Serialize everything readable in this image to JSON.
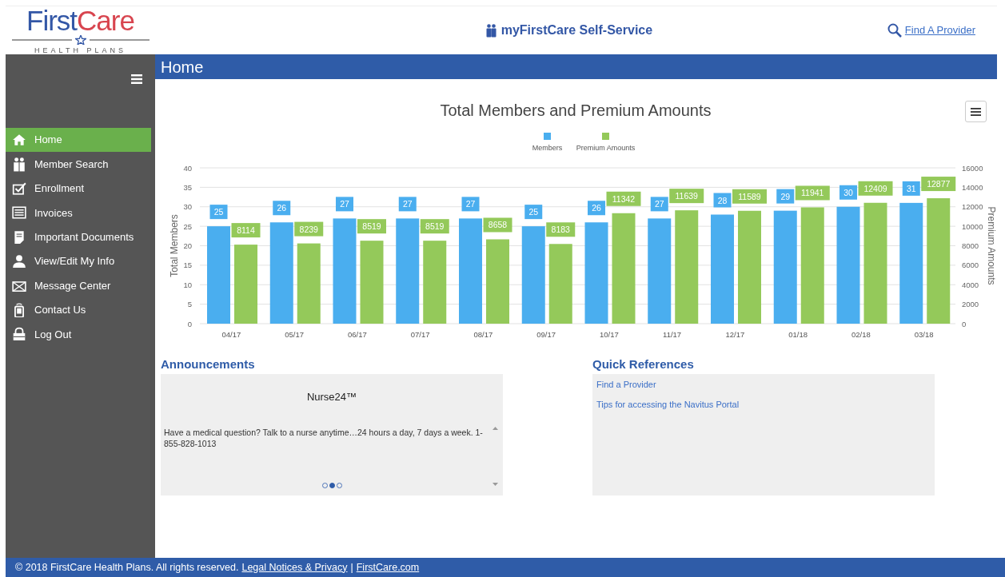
{
  "logo": {
    "brand_first": "First",
    "brand_second": "Care",
    "tagline": "HEALTH PLANS"
  },
  "header": {
    "title": "myFirstCare Self-Service",
    "link": "Find A Provider"
  },
  "sidebar": {
    "items": [
      {
        "label": "Home",
        "kind": "home",
        "selected": true
      },
      {
        "label": "Member Search",
        "kind": "members",
        "selected": false
      },
      {
        "label": "Enrollment",
        "kind": "checkbox",
        "selected": false
      },
      {
        "label": "Invoices",
        "kind": "list",
        "selected": false
      },
      {
        "label": "Important Documents",
        "kind": "document",
        "selected": false
      },
      {
        "label": "View/Edit My Info",
        "kind": "person",
        "selected": false
      },
      {
        "label": "Message Center",
        "kind": "mail",
        "selected": false
      },
      {
        "label": "Contact Us",
        "kind": "phone",
        "selected": false
      },
      {
        "label": "Log Out",
        "kind": "lock",
        "selected": false
      }
    ]
  },
  "page_title": "Home",
  "chart": {
    "chart_data": {
      "type": "bar",
      "title": "Total Members and Premium Amounts",
      "ylabel": "Total Members",
      "categories": [
        "04/17",
        "05/17",
        "06/17",
        "07/17",
        "08/17",
        "09/17",
        "10/17",
        "11/17",
        "12/17",
        "01/18",
        "02/18",
        "03/18"
      ],
      "series": [
        {
          "name": "Members",
          "color": "#4aaeef",
          "values": [
            25,
            26,
            27,
            27,
            27,
            25,
            26,
            27,
            28,
            29,
            30,
            31
          ]
        }
      ],
      "ylim": [
        0,
        40
      ],
      "yticks": [
        0,
        5,
        10,
        15,
        20,
        25,
        30,
        35,
        40
      ],
      "grid": true,
      "data_labels": true
    },
    "right_axis": {
      "chart_data": {
        "type": "bar",
        "ylabel": "Premium Amounts",
        "series": [
          {
            "name": "Premium Amounts",
            "color": "#94c95a",
            "values": [
              8114,
              8239,
              8519,
              8519,
              8658,
              8183,
              11342,
              11639,
              11589,
              11941,
              12409,
              12877
            ]
          }
        ],
        "ylim": [
          0,
          16000
        ],
        "yticks": [
          0,
          2000,
          4000,
          6000,
          8000,
          10000,
          12000,
          14000,
          16000
        ],
        "data_labels": true
      }
    }
  },
  "announcements": {
    "heading": "Announcements",
    "slide": {
      "title": "Nurse24™",
      "text": "Have a medical question? Talk to a nurse anytime…24 hours a day, 7 days a week. 1-855-828-1013"
    },
    "dots": [
      {
        "selected": false
      },
      {
        "selected": true
      },
      {
        "selected": false
      }
    ]
  },
  "quick_references": {
    "heading": "Quick References",
    "links": [
      "Find a Provider",
      "Tips for accessing the Navitus Portal"
    ]
  },
  "footer": {
    "copyright": "© 2018 FirstCare Health Plans. All rights reserved.",
    "links": [
      "Legal Notices & Privacy",
      "FirstCare.com"
    ],
    "separator": "|"
  }
}
